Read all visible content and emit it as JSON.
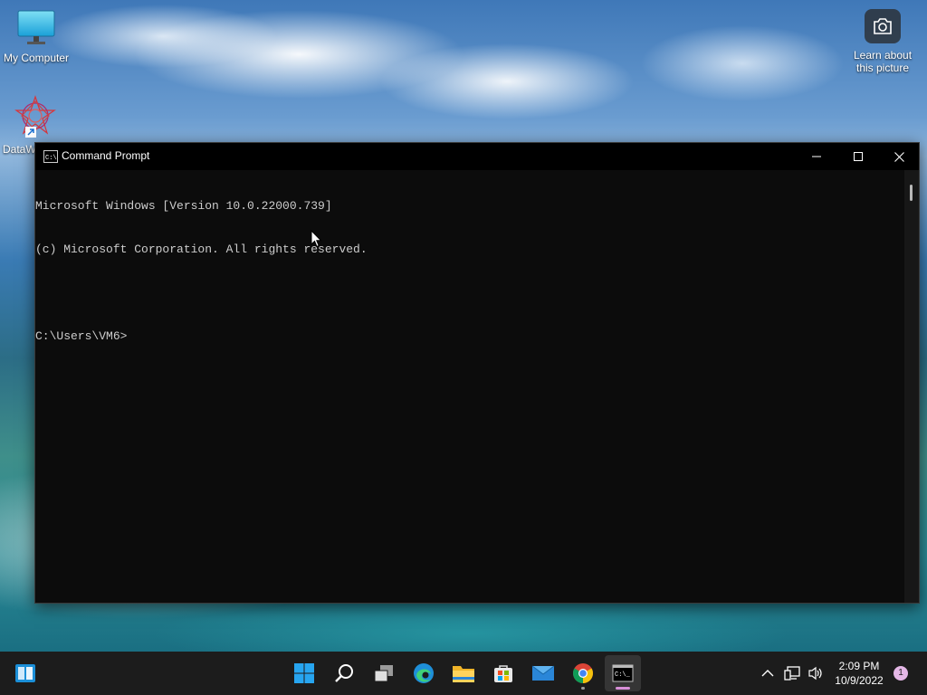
{
  "desktop": {
    "icons": [
      {
        "label": "My Computer",
        "icon": "monitor-icon"
      },
      {
        "label": "DataW",
        "icon": "datawatch-icon"
      }
    ],
    "spotlight": {
      "label_line1": "Learn about",
      "label_line2": "this picture",
      "icon": "camera-icon"
    }
  },
  "window": {
    "title": "Command Prompt",
    "icon": "console-icon",
    "controls": [
      "minimize-icon",
      "maximize-icon",
      "close-icon"
    ],
    "console_lines": [
      "Microsoft Windows [Version 10.0.22000.739]",
      "(c) Microsoft Corporation. All rights reserved.",
      "",
      "C:\\Users\\VM6>"
    ]
  },
  "taskbar": {
    "pinned": [
      "widgets-icon",
      "start-icon",
      "search-icon",
      "task-view-icon",
      "edge-icon",
      "file-explorer-icon",
      "store-icon",
      "mail-icon",
      "chrome-icon",
      "terminal-icon"
    ],
    "active_app": "terminal-icon",
    "tray": {
      "icons": [
        "chevron-up-icon",
        "network-icon",
        "volume-icon"
      ],
      "time": "2:09 PM",
      "date": "10/9/2022",
      "notification_count": "1"
    }
  },
  "colors": {
    "console_bg": "#0c0c0c",
    "console_text": "#cccccc",
    "taskbar_bg": "#1c1c1c",
    "accent": "#0078d4"
  }
}
